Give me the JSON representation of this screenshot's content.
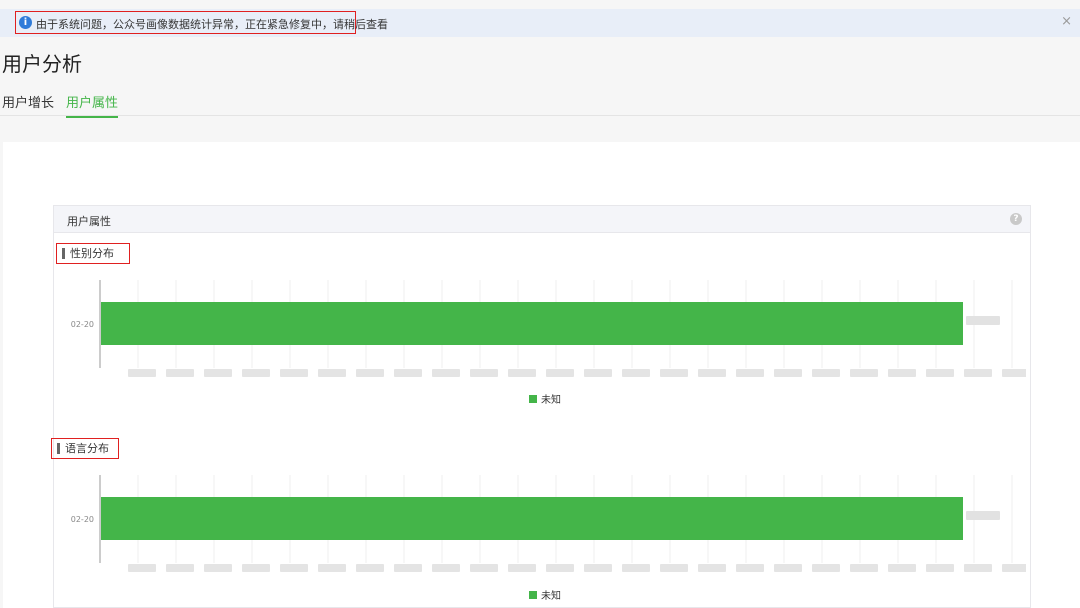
{
  "notice": {
    "icon": "info-icon",
    "text": "由于系统问题，公众号画像数据统计异常，正在紧急修复中，请稍后查看",
    "close": "×"
  },
  "page": {
    "title": "用户分析",
    "tabs": [
      {
        "label": "用户增长",
        "active": false
      },
      {
        "label": "用户属性",
        "active": true
      }
    ]
  },
  "panel": {
    "title": "用户属性",
    "help_icon": "question-circle-icon",
    "help_symbol": "?"
  },
  "sections": [
    {
      "label": "性别分布"
    },
    {
      "label": "语言分布"
    }
  ],
  "colors": {
    "accent": "#44b549",
    "notice_bg": "#e8eef8",
    "highlight_border": "#e02020"
  },
  "chart_data": [
    {
      "type": "bar",
      "orientation": "horizontal",
      "categories": [
        "02-20"
      ],
      "series": [
        {
          "name": "未知",
          "values": [
            1
          ]
        }
      ],
      "grid": true,
      "legend_position": "bottom"
    },
    {
      "type": "bar",
      "orientation": "horizontal",
      "categories": [
        "02-20"
      ],
      "series": [
        {
          "name": "未知",
          "values": [
            1
          ]
        }
      ],
      "grid": true,
      "legend_position": "bottom"
    }
  ]
}
